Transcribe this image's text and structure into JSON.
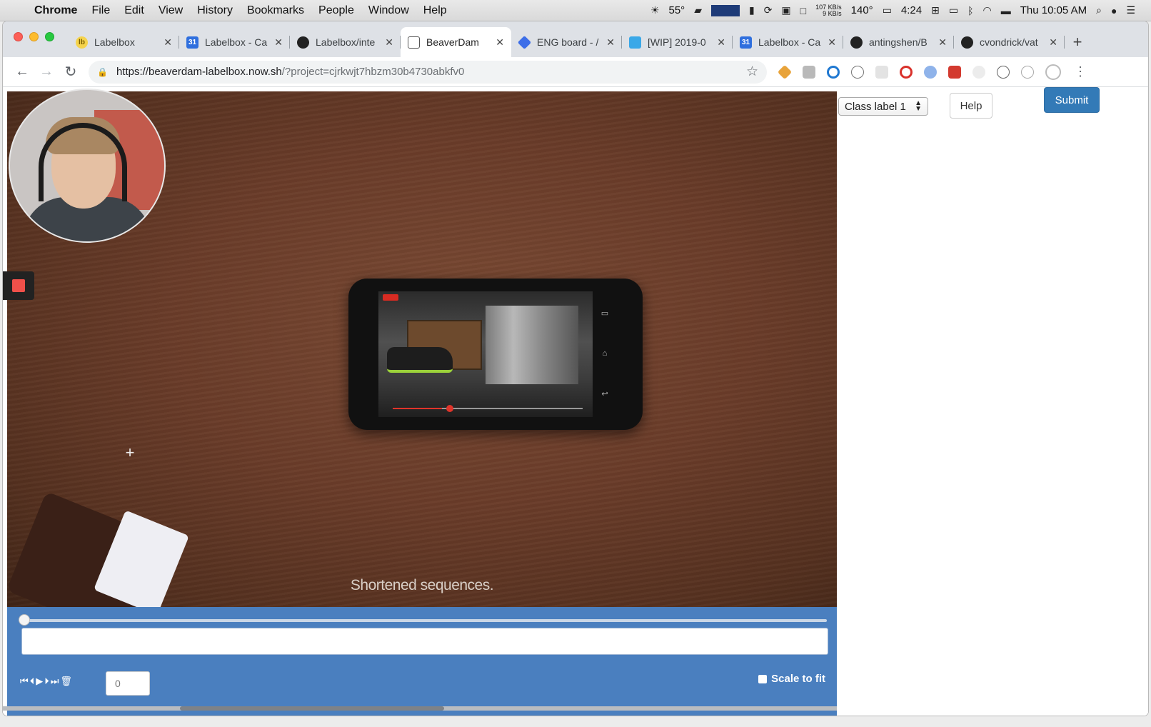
{
  "menubar": {
    "app": "Chrome",
    "items": [
      "File",
      "Edit",
      "View",
      "History",
      "Bookmarks",
      "People",
      "Window",
      "Help"
    ],
    "weather": "55°",
    "net_up": "107 KB/s",
    "net_down": "9 KB/s",
    "temp": "140°",
    "battery_time": "4:24",
    "clock": "Thu 10:05 AM"
  },
  "tabs": [
    {
      "title": "Labelbox",
      "favicon": "labelbox-icon",
      "fav_text": "lb"
    },
    {
      "title": "Labelbox - Ca",
      "favicon": "calendar-icon",
      "fav_text": "31"
    },
    {
      "title": "Labelbox/inte",
      "favicon": "github-icon",
      "fav_text": ""
    },
    {
      "title": "BeaverDam",
      "favicon": "document-icon",
      "fav_text": "",
      "active": true
    },
    {
      "title": "ENG board - /",
      "favicon": "jira-icon",
      "fav_text": ""
    },
    {
      "title": "[WIP] 2019-0",
      "favicon": "wip-icon",
      "fav_text": ""
    },
    {
      "title": "Labelbox - Ca",
      "favicon": "calendar-icon",
      "fav_text": "31"
    },
    {
      "title": "antingshen/B",
      "favicon": "github-icon",
      "fav_text": ""
    },
    {
      "title": "cvondrick/vat",
      "favicon": "github-icon",
      "fav_text": ""
    }
  ],
  "omnibox": {
    "host": "https://beaverdam-labelbox.now.sh",
    "path": "/?project=cjrkwjt7hbzm30b4730abkfv0"
  },
  "video": {
    "caption": "Shortened sequences."
  },
  "controls": {
    "frame": "0",
    "scale_to_fit": "Scale to fit",
    "timeline_position": 0.0
  },
  "panel": {
    "class_label": "Class label 1",
    "help": "Help",
    "submit": "Submit"
  },
  "colors": {
    "controls_bg": "#4a7fbf",
    "submit_bg": "#337ab7",
    "record": "#f0504a"
  }
}
